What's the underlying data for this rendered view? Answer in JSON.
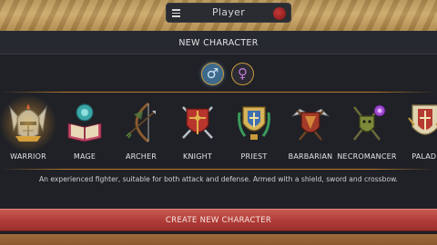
{
  "top_bar": {
    "menu_icon": "hamburger-menu-icon",
    "player_name": "Player",
    "status_color": "#b62a2a"
  },
  "panel": {
    "title": "NEW CHARACTER",
    "gender": {
      "selected": "male",
      "options": [
        {
          "id": "male",
          "icon": "male-symbol-icon",
          "glyph": "♂"
        },
        {
          "id": "female",
          "icon": "female-symbol-icon",
          "glyph": "♀"
        }
      ]
    },
    "classes": [
      {
        "label": "WARRIOR",
        "icon": "warrior-helmet-icon",
        "selected": true
      },
      {
        "label": "MAGE",
        "icon": "mage-spellbook-icon",
        "selected": false
      },
      {
        "label": "ARCHER",
        "icon": "archer-bow-icon",
        "selected": false
      },
      {
        "label": "KNIGHT",
        "icon": "knight-shield-sword-icon",
        "selected": false
      },
      {
        "label": "PRIEST",
        "icon": "priest-chalice-icon",
        "selected": false
      },
      {
        "label": "BARBARIAN",
        "icon": "barbarian-axe-icon",
        "selected": false
      },
      {
        "label": "NECROMANCER",
        "icon": "necromancer-staff-icon",
        "selected": false
      },
      {
        "label": "PALADI",
        "icon": "paladin-crest-icon",
        "selected": false
      }
    ],
    "description": "An experienced fighter, suitable for both attack and defense. Armed with a shield, sword and crossbow.",
    "create_button": "CREATE NEW CHARACTER"
  },
  "colors": {
    "accent_gold": "#c79a3c",
    "button_red": "#b03c38",
    "panel_bg": "#1f2126"
  }
}
